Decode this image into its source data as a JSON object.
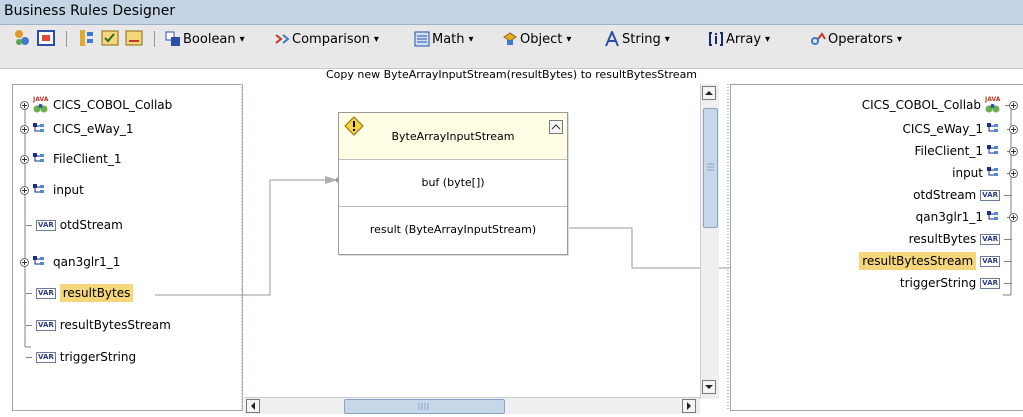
{
  "window": {
    "title": "Business Rules Designer"
  },
  "toolbar": {
    "menus": [
      {
        "label": "Boolean",
        "icon": "boolean-icon"
      },
      {
        "label": "Comparison",
        "icon": "comparison-icon"
      },
      {
        "label": "Math",
        "icon": "math-icon"
      },
      {
        "label": "Object",
        "icon": "object-icon"
      },
      {
        "label": "String",
        "icon": "string-icon"
      },
      {
        "label": "Array",
        "icon": "array-icon"
      },
      {
        "label": "Operators",
        "icon": "operators-icon"
      }
    ],
    "dropdown_glyph": "▾"
  },
  "caption": "Copy new ByteArrayInputStream(resultBytes) to resultBytesStream",
  "left_tree": {
    "root": "CICS_COBOL_Collab",
    "items": [
      {
        "label": "CICS_eWay_1",
        "kind": "type"
      },
      {
        "label": "FileClient_1",
        "kind": "type"
      },
      {
        "label": "input",
        "kind": "type"
      },
      {
        "label": "otdStream",
        "kind": "var"
      },
      {
        "label": "qan3glr1_1",
        "kind": "type"
      },
      {
        "label": "resultBytes",
        "kind": "var"
      },
      {
        "label": "resultBytesStream",
        "kind": "var"
      },
      {
        "label": "triggerString",
        "kind": "var"
      }
    ],
    "var_badge": "VAR",
    "java_badge": "JAVA"
  },
  "method_box": {
    "title": "ByteArrayInputStream",
    "param": "buf (byte[])",
    "result": "result (ByteArrayInputStream)"
  },
  "right_tree": {
    "root": "CICS_COBOL_Collab",
    "items": [
      {
        "label": "CICS_eWay_1",
        "kind": "type"
      },
      {
        "label": "FileClient_1",
        "kind": "type"
      },
      {
        "label": "input",
        "kind": "type"
      },
      {
        "label": "otdStream",
        "kind": "var"
      },
      {
        "label": "qan3glr1_1",
        "kind": "type"
      },
      {
        "label": "resultBytes",
        "kind": "var"
      },
      {
        "label": "resultBytesStream",
        "kind": "var"
      },
      {
        "label": "triggerString",
        "kind": "var"
      }
    ]
  },
  "colors": {
    "titlebar": "#c4d4e4",
    "highlight": "#f6d67a",
    "header": "#fffde3",
    "scroll_thumb": "#c7d7ea"
  }
}
